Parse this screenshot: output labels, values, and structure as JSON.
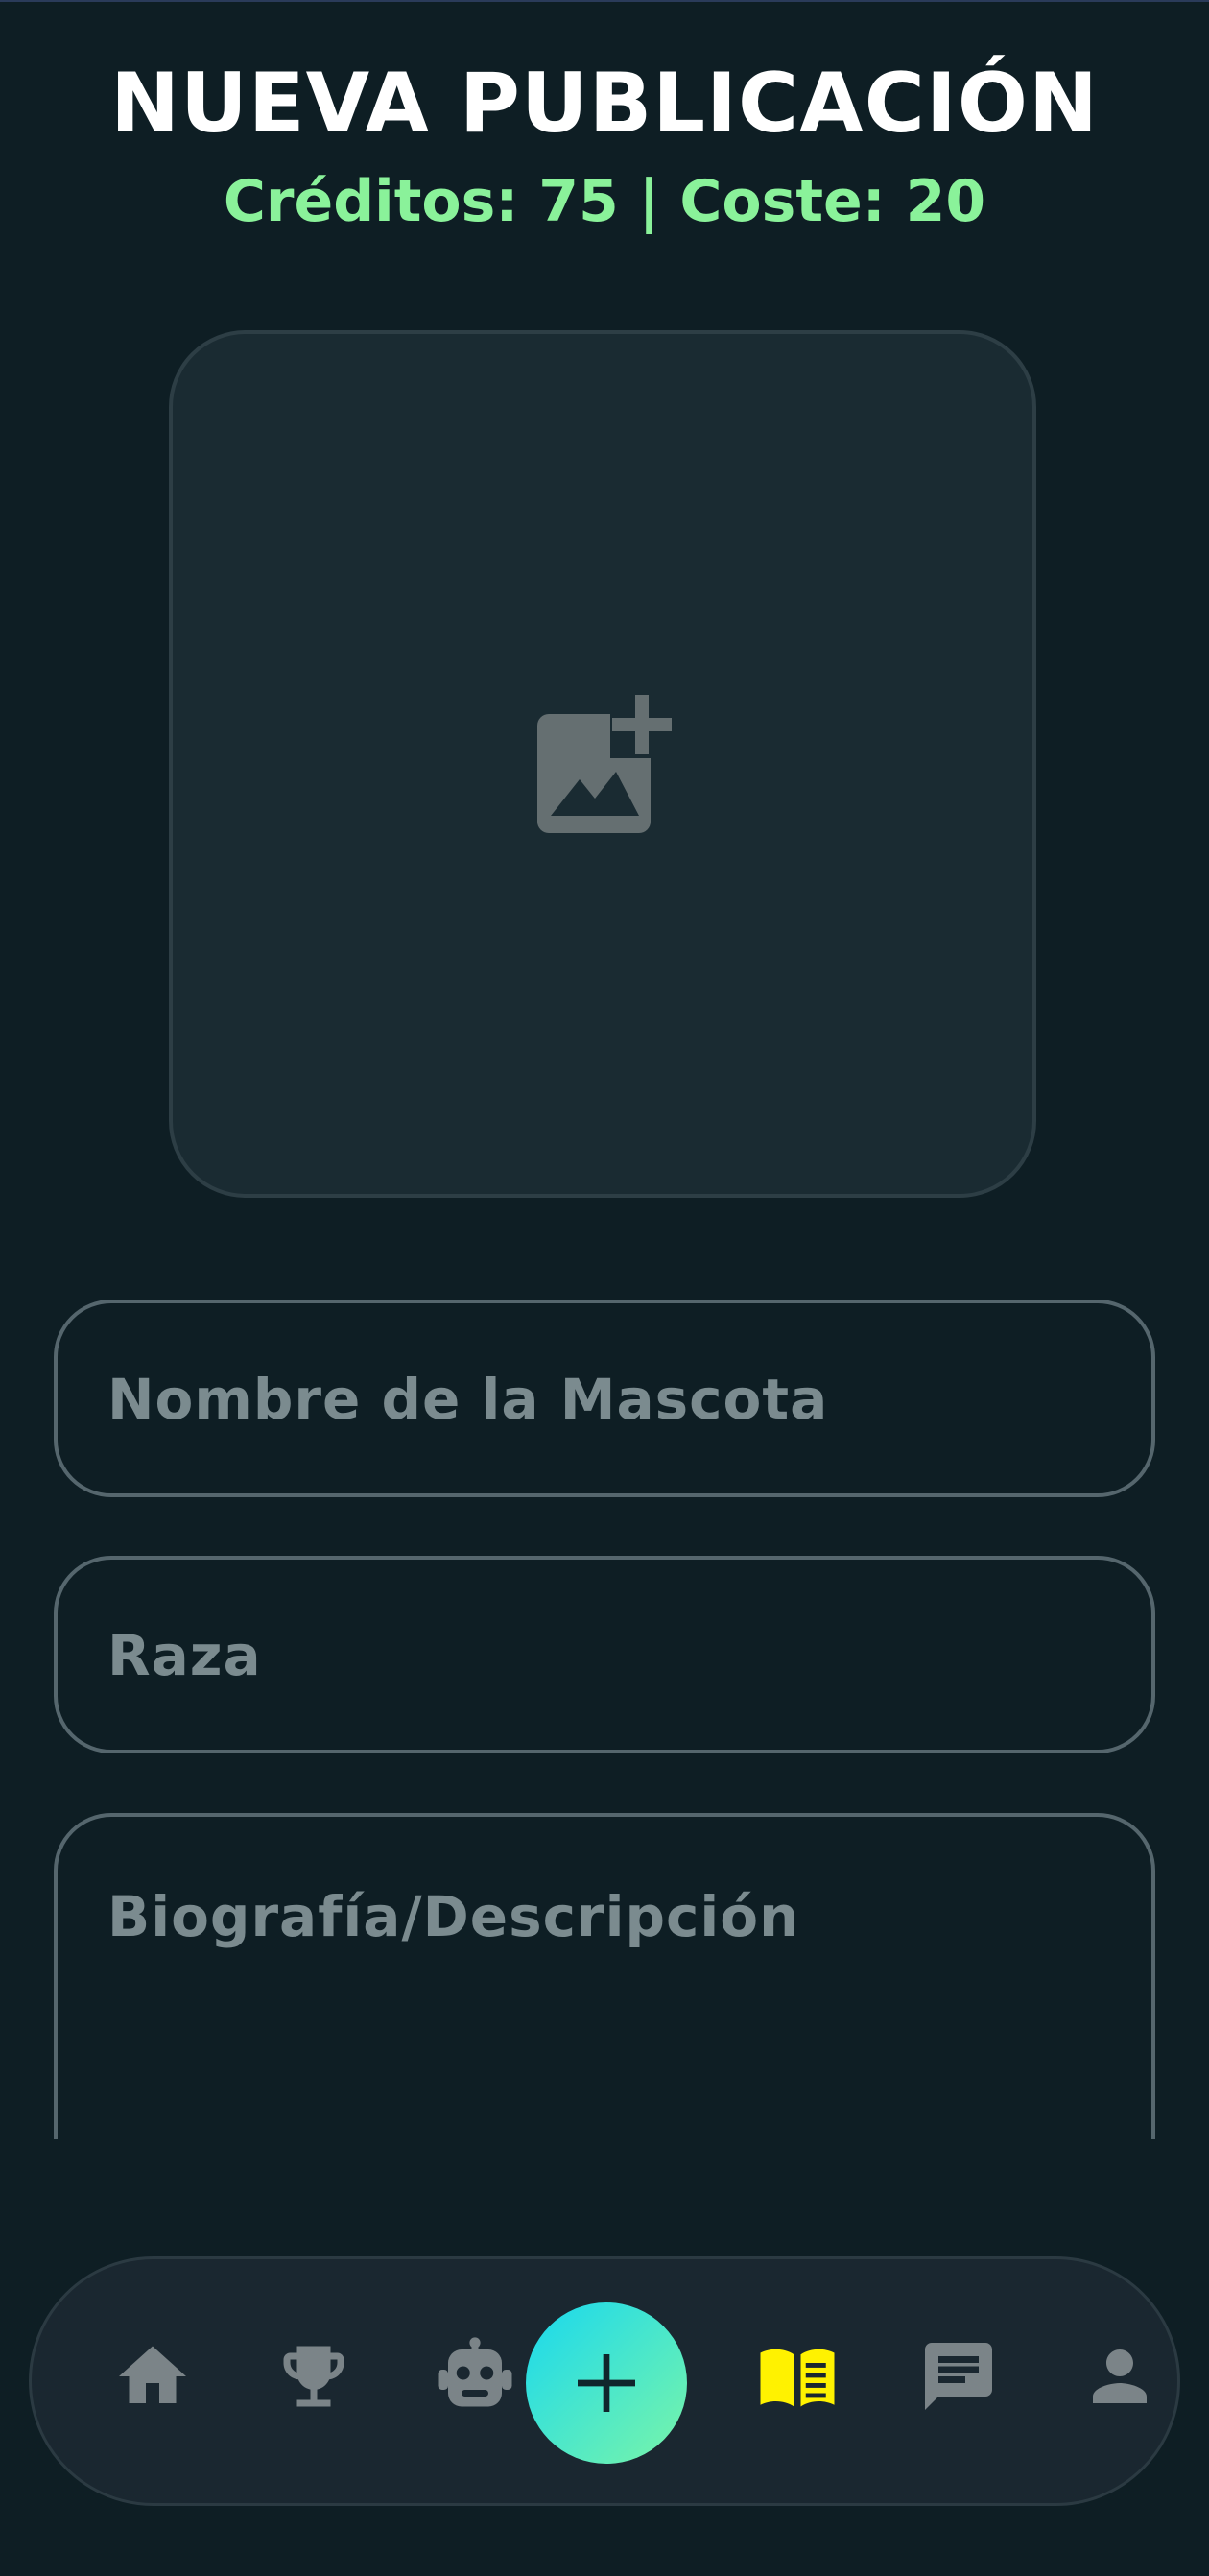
{
  "header": {
    "title": "NUEVA PUBLICACIÓN",
    "credits_text": "Créditos: 75 | Coste: 20"
  },
  "image_picker": {
    "icon": "add-photo-icon"
  },
  "form": {
    "pet_name": {
      "value": "",
      "placeholder": "Nombre de la Mascota"
    },
    "breed": {
      "value": "",
      "placeholder": "Raza"
    },
    "bio": {
      "value": "",
      "placeholder": "Biografía/Descripción"
    }
  },
  "bottom_nav": {
    "items": [
      {
        "icon": "home-icon",
        "active": false
      },
      {
        "icon": "trophy-icon",
        "active": false
      },
      {
        "icon": "robot-icon",
        "active": false
      },
      {
        "icon": "plus-icon",
        "active": false
      },
      {
        "icon": "open-book-icon",
        "active": true
      },
      {
        "icon": "chat-icon",
        "active": false
      },
      {
        "icon": "person-icon",
        "active": false
      }
    ]
  },
  "colors": {
    "background": "#0e1e24",
    "accent_green": "#8af29a",
    "active_yellow": "#fff200",
    "icon_gray": "#7b8488",
    "fab_gradient_start": "#18d8ef",
    "fab_gradient_end": "#7af5a8"
  }
}
